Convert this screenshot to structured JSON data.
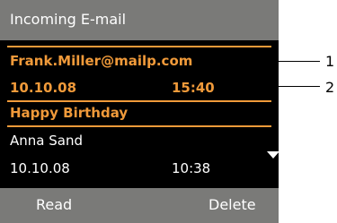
{
  "header": {
    "title": "Incoming E-mail"
  },
  "messages": [
    {
      "sender": "Frank.Miller@mailp.com",
      "date": "10.10.08",
      "time": "15:40",
      "subject": "Happy Birthday"
    },
    {
      "sender": "Anna Sand",
      "date": "10.10.08",
      "time": "10:38"
    }
  ],
  "softkeys": {
    "left": "Read",
    "right": "Delete"
  },
  "callouts": [
    "1",
    "2"
  ],
  "icons": {
    "scroll": "scroll-down-icon"
  },
  "colors": {
    "accent": "#f09a3a",
    "bar": "#7a7a78",
    "screen": "#000000"
  }
}
